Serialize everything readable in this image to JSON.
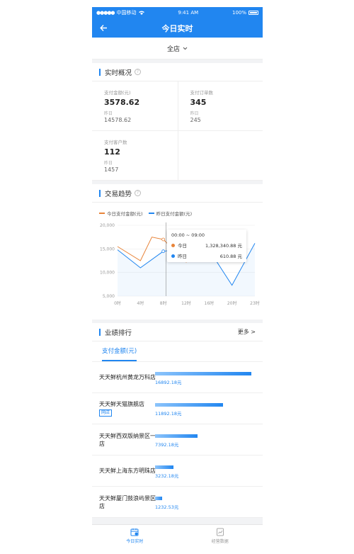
{
  "status": {
    "carrier": "中国移动",
    "time": "9:41 AM",
    "battery": "100%"
  },
  "nav": {
    "title": "今日实时"
  },
  "store": {
    "selected": "全店"
  },
  "overview": {
    "title": "实时概况",
    "metrics": [
      {
        "label": "支付金额(元)",
        "value": "3578.62",
        "yesterday_label": "昨日",
        "yesterday_value": "14578.62"
      },
      {
        "label": "支付订单数",
        "value": "345",
        "yesterday_label": "昨日",
        "yesterday_value": "245"
      },
      {
        "label": "支付客户数",
        "value": "112",
        "yesterday_label": "昨日",
        "yesterday_value": "1457"
      }
    ]
  },
  "trend": {
    "title": "交易趋势",
    "tooltip": {
      "time": "00:00 ~ 09:00",
      "today_label": "今日",
      "today_value": "1,328,340.88 元",
      "yesterday_label": "昨日",
      "yesterday_value": "610.88 元"
    }
  },
  "chart_data": {
    "type": "line",
    "x": [
      "0时",
      "4时",
      "8时",
      "12时",
      "16时",
      "20时",
      "23时"
    ],
    "ylim": [
      5000,
      20000
    ],
    "yticks": [
      "20,000",
      "15,000",
      "10,000",
      "5,000"
    ],
    "series": [
      {
        "name": "今日支付金额(元)",
        "color": "#e8843a",
        "points": [
          [
            0,
            15500
          ],
          [
            4,
            12500
          ],
          [
            6,
            17500
          ],
          [
            8,
            17000
          ],
          [
            12,
            12200
          ],
          [
            16,
            17500
          ]
        ]
      },
      {
        "name": "昨日支付金额(元)",
        "color": "#2186f0",
        "points": [
          [
            0,
            14800
          ],
          [
            4,
            11000
          ],
          [
            8,
            14500
          ],
          [
            12,
            15000
          ],
          [
            16,
            14800
          ],
          [
            20,
            7300
          ],
          [
            24,
            16200
          ]
        ]
      }
    ]
  },
  "ranking": {
    "title": "业绩排行",
    "more": "更多 >",
    "tab": "支付金额(元)",
    "items": [
      {
        "name": "天天鲜杭州黄龙万科店",
        "value": "16892.18元",
        "amount": 16892.18,
        "tag": ""
      },
      {
        "name": "天天鲜天猫旗舰店",
        "value": "11892.18元",
        "amount": 11892.18,
        "tag": "网店"
      },
      {
        "name": "天天鲜西双版纳景区一店",
        "value": "7392.18元",
        "amount": 7392.18,
        "tag": ""
      },
      {
        "name": "天天鲜上海东方明珠店",
        "value": "3232.18元",
        "amount": 3232.18,
        "tag": ""
      },
      {
        "name": "天天鲜厦门鼓浪屿景区店",
        "value": "1232.53元",
        "amount": 1232.53,
        "tag": ""
      }
    ]
  },
  "bottom_tabs": [
    {
      "label": "今日实时",
      "icon": "calendar-icon",
      "active": true
    },
    {
      "label": "经营数据",
      "icon": "report-icon",
      "active": false
    }
  ]
}
